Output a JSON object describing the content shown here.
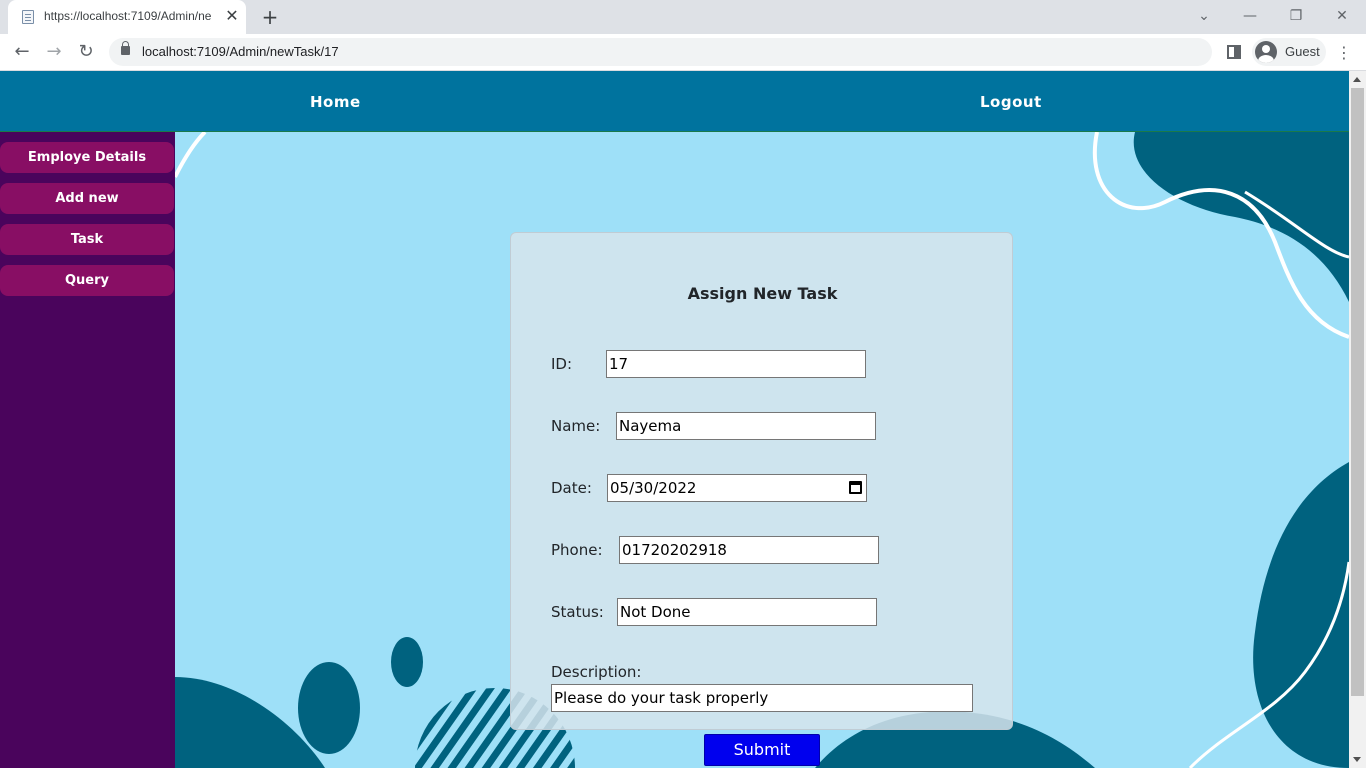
{
  "browser": {
    "tab_title": "https://localhost:7109/Admin/ne",
    "tab_close": "✕",
    "new_tab": "+",
    "url": "localhost:7109/Admin/newTask/17",
    "profile_name": "Guest",
    "minimize": "—",
    "restore": "❐",
    "close": "✕",
    "tab_search": "⌄",
    "back": "←",
    "forward": "→",
    "reload": "↻",
    "menu": "⋮"
  },
  "topnav": {
    "home": "Home",
    "logout": "Logout"
  },
  "sidebar": {
    "items": [
      {
        "label": "Employe Details"
      },
      {
        "label": "Add new"
      },
      {
        "label": "Task"
      },
      {
        "label": "Query"
      }
    ]
  },
  "form": {
    "title": "Assign New Task",
    "id_label": "ID:",
    "id_value": "17",
    "name_label": "Name:",
    "name_value": "Nayema",
    "date_label": "Date:",
    "date_value": "05/30/2022",
    "phone_label": "Phone:",
    "phone_value": "01720202918",
    "status_label": "Status:",
    "status_value": "Not Done",
    "description_label": "Description:",
    "description_value": "Please do your task properly",
    "submit_label": "Submit"
  },
  "colors": {
    "nav_bg": "#00739e",
    "sidebar_bg": "#4a045c",
    "sidebar_button": "#880e64",
    "content_bg": "#9ee0f8",
    "shape_dark": "#00627f",
    "submit_bg": "#0000ee"
  }
}
